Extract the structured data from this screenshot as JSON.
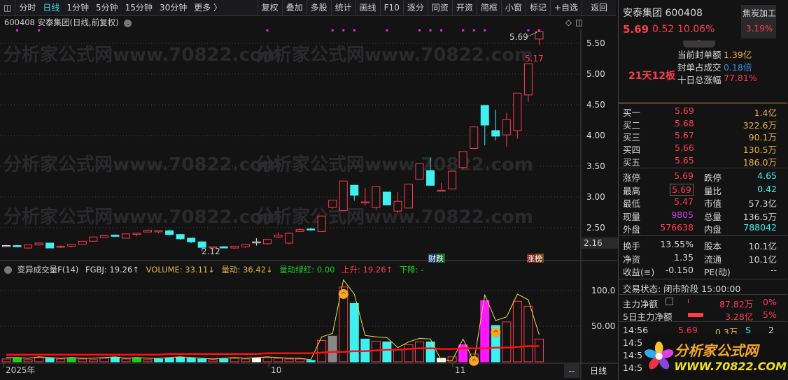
{
  "toolbar": {
    "left": [
      "分时",
      "日线",
      "1分钟",
      "5分钟",
      "15分钟",
      "30分钟",
      "更多 〉"
    ],
    "right": [
      "复权",
      "叠加",
      "多股",
      "统计",
      "画线",
      "F10",
      "逐分",
      "同资",
      "开资",
      "简框",
      "小窗",
      "标记",
      "+自选",
      "返回"
    ]
  },
  "subtitle": "600408 安泰集团(日线,前复权)",
  "watermark": "分析家公式网www.70822.com",
  "price_axis": [
    "5.50",
    "5.00",
    "4.50",
    "4.00",
    "3.50",
    "3.00",
    "2.50"
  ],
  "price_current": "2.16",
  "annotations": {
    "high": "5.69",
    "peak": "5.17",
    "low": "2.12",
    "tag1": "财跌",
    "tag2": "涨榜"
  },
  "candles": [
    [
      2.21,
      2.22,
      2.2,
      2.21
    ],
    [
      2.21,
      2.22,
      2.18,
      2.19
    ],
    [
      2.17,
      2.22,
      2.16,
      2.22
    ],
    [
      2.22,
      2.26,
      2.21,
      2.25
    ],
    [
      2.25,
      2.26,
      2.17,
      2.17
    ],
    [
      2.19,
      2.21,
      2.17,
      2.2
    ],
    [
      2.2,
      2.23,
      2.18,
      2.23
    ],
    [
      2.23,
      2.28,
      2.23,
      2.28
    ],
    [
      2.28,
      2.35,
      2.28,
      2.35
    ],
    [
      2.34,
      2.37,
      2.33,
      2.37
    ],
    [
      2.38,
      2.39,
      2.35,
      2.36
    ],
    [
      2.33,
      2.4,
      2.33,
      2.4
    ],
    [
      2.4,
      2.41,
      2.36,
      2.41
    ],
    [
      2.43,
      2.47,
      2.43,
      2.46
    ],
    [
      2.45,
      2.45,
      2.41,
      2.45
    ],
    [
      2.45,
      2.47,
      2.37,
      2.39
    ],
    [
      2.39,
      2.4,
      2.3,
      2.32
    ],
    [
      2.33,
      2.33,
      2.25,
      2.27
    ],
    [
      2.27,
      2.29,
      2.12,
      2.18
    ],
    [
      2.18,
      2.19,
      2.18,
      2.19
    ],
    [
      2.19,
      2.2,
      2.17,
      2.17
    ],
    [
      2.17,
      2.2,
      2.15,
      2.2
    ],
    [
      2.19,
      2.24,
      2.17,
      2.23
    ],
    [
      2.27,
      2.33,
      2.21,
      2.27
    ],
    [
      2.24,
      2.31,
      2.22,
      2.31
    ],
    [
      2.35,
      2.42,
      2.33,
      2.38
    ],
    [
      2.25,
      2.42,
      2.23,
      2.41
    ],
    [
      2.44,
      2.49,
      2.44,
      2.47
    ],
    [
      2.48,
      2.5,
      2.45,
      2.47
    ],
    [
      2.44,
      2.7,
      2.43,
      2.69
    ],
    [
      2.83,
      2.95,
      2.81,
      2.95
    ],
    [
      2.78,
      3.26,
      2.78,
      3.26
    ],
    [
      3.19,
      3.2,
      2.94,
      3.03
    ],
    [
      2.92,
      3.15,
      2.86,
      2.92
    ],
    [
      2.83,
      3.17,
      2.79,
      3.17
    ],
    [
      3.08,
      3.08,
      2.87,
      2.87
    ],
    [
      2.77,
      3.08,
      2.74,
      2.93
    ],
    [
      2.82,
      3.21,
      2.82,
      3.21
    ],
    [
      3.29,
      3.54,
      3.29,
      3.54
    ],
    [
      3.43,
      3.64,
      3.19,
      3.19
    ],
    [
      3.1,
      3.23,
      3.1,
      3.11
    ],
    [
      3.13,
      3.42,
      3.13,
      3.42
    ],
    [
      3.48,
      3.74,
      3.45,
      3.74
    ],
    [
      3.79,
      4.14,
      3.77,
      4.14
    ],
    [
      4.49,
      4.49,
      3.84,
      4.17
    ],
    [
      4.08,
      4.42,
      3.92,
      3.99
    ],
    [
      4.01,
      4.37,
      3.82,
      4.26
    ],
    [
      4.08,
      4.69,
      3.95,
      4.69
    ],
    [
      4.66,
      5.17,
      4.55,
      5.17
    ],
    [
      5.57,
      5.69,
      5.47,
      5.69
    ]
  ],
  "signal_dots": [
    1,
    3,
    24,
    30,
    31,
    32,
    35,
    38,
    39,
    40,
    42,
    43,
    44,
    48,
    49
  ],
  "volume_axis": [
    "100.0",
    "50.00"
  ],
  "volume": {
    "values": [
      4,
      5,
      3,
      6,
      5,
      4,
      5,
      4,
      3,
      5,
      6,
      4,
      5,
      3,
      4,
      5,
      6,
      5,
      4,
      3,
      4,
      5,
      4,
      5,
      6,
      5,
      4,
      4,
      2,
      30,
      36,
      105,
      82,
      32,
      29,
      28,
      17,
      24,
      28,
      28,
      5,
      7,
      24,
      11,
      86,
      51,
      56,
      85,
      78,
      32
    ],
    "colors": [
      "r",
      "g",
      "r",
      "r",
      "c",
      "r",
      "g",
      "r",
      "r",
      "r",
      "c",
      "r",
      "g",
      "r",
      "c",
      "c",
      "c",
      "c",
      "c",
      "r",
      "c",
      "r",
      "r",
      "w",
      "r",
      "r",
      "r",
      "r",
      "c",
      "r",
      "gray",
      "r",
      "c",
      "c",
      "r",
      "c",
      "r",
      "r",
      "r",
      "c",
      "w",
      "r",
      "m",
      "r",
      "m",
      "c",
      "r",
      "r",
      "r",
      "r"
    ],
    "line": [
      6,
      6,
      5,
      7,
      6,
      5,
      6,
      5,
      5,
      6,
      7,
      5,
      6,
      5,
      5,
      6,
      7,
      6,
      5,
      4,
      5,
      6,
      5,
      6,
      7,
      6,
      5,
      5,
      3,
      35,
      40,
      115,
      95,
      37,
      35,
      34,
      20,
      28,
      33,
      32,
      2,
      2,
      32,
      0,
      94,
      58,
      63,
      95,
      87,
      38
    ],
    "ma": [
      10,
      10,
      10,
      10,
      10,
      10,
      10,
      10,
      10,
      10,
      10,
      10,
      10,
      10,
      10,
      11,
      11,
      11,
      11,
      11,
      11,
      11,
      11,
      11,
      12,
      12,
      12,
      12,
      12,
      13,
      14,
      14,
      15,
      15,
      16,
      17,
      17,
      18,
      19,
      19,
      18,
      18,
      19,
      19,
      19,
      20,
      20,
      21,
      22,
      22
    ],
    "markers": [
      31,
      43,
      45
    ]
  },
  "dates": [
    "2025年",
    "10",
    "11"
  ],
  "period_label": "日线",
  "scroll_label": "--",
  "indicator": {
    "name": "变异成交量F(14)",
    "fgbj": "FGBJ: 19.26↑",
    "volume": "VOLUME: 33.11↓",
    "ld": "量动: 36.42↓",
    "ldlh": "量动绿红: 0.00",
    "up": "上升: 19.26↑",
    "down": "下降: -"
  },
  "quote": {
    "name": "安泰集团 600408",
    "price": "5.69",
    "change": "0.52",
    "pct": "10.06%",
    "sector": "焦炭加工",
    "sector_pct": "3.19%",
    "board": "21天12板",
    "seal_amount_label": "当前封单额",
    "seal_amount": "1.39亿",
    "seal_ratio_label": "封单占成交",
    "seal_ratio": "0.18倍",
    "ten_day_label": "十日总涨幅",
    "ten_day": "77.81%",
    "bids": [
      {
        "label": "买一",
        "price": "5.69",
        "vol": "1.4亿"
      },
      {
        "label": "买二",
        "price": "5.68",
        "vol": "322.6万"
      },
      {
        "label": "买三",
        "price": "5.67",
        "vol": "90.1万"
      },
      {
        "label": "买四",
        "price": "5.66",
        "vol": "130.5万"
      },
      {
        "label": "买五",
        "price": "5.65",
        "vol": "186.0万"
      }
    ],
    "stats": [
      [
        "涨停",
        "5.69",
        "跌停",
        "4.65"
      ],
      [
        "最高",
        "5.69",
        "量比",
        "0.42"
      ],
      [
        "最低",
        "5.47",
        "市值",
        "57.3亿"
      ],
      [
        "现量",
        "9805",
        "总量",
        "136.5万"
      ],
      [
        "外盘",
        "576638",
        "内盘",
        "788042"
      ]
    ],
    "fund": [
      [
        "换手",
        "13.55%",
        "股本",
        "10.1亿"
      ],
      [
        "净资",
        "1.35",
        "流通",
        "10.1亿"
      ],
      [
        "收益(≡)",
        "-0.150",
        "PE(动)",
        "--"
      ]
    ],
    "status": "交易状态: 闭市阶段 15:00:00",
    "main_flow_label": "主力净额",
    "main_flow": "87.82万",
    "main_flow_pct": "0%",
    "flow5_label": "5日主力净额",
    "flow5": "3.28亿",
    "flow5_pct": "5%",
    "ticks": [
      {
        "time": "14:56",
        "price": "5.69",
        "vol": "0.3万",
        "side": "S",
        "n": "2"
      },
      {
        "time": "14:5"
      },
      {
        "time": "14:5"
      },
      {
        "time": "14:5"
      }
    ]
  },
  "logo": {
    "title": "分析家公式网",
    "url": "WWW.70822.COM"
  },
  "colors": {
    "up": "#ff3b4a",
    "down": "#3ff0f0",
    "magenta": "#ff18ff",
    "yellow": "#e8e040"
  }
}
